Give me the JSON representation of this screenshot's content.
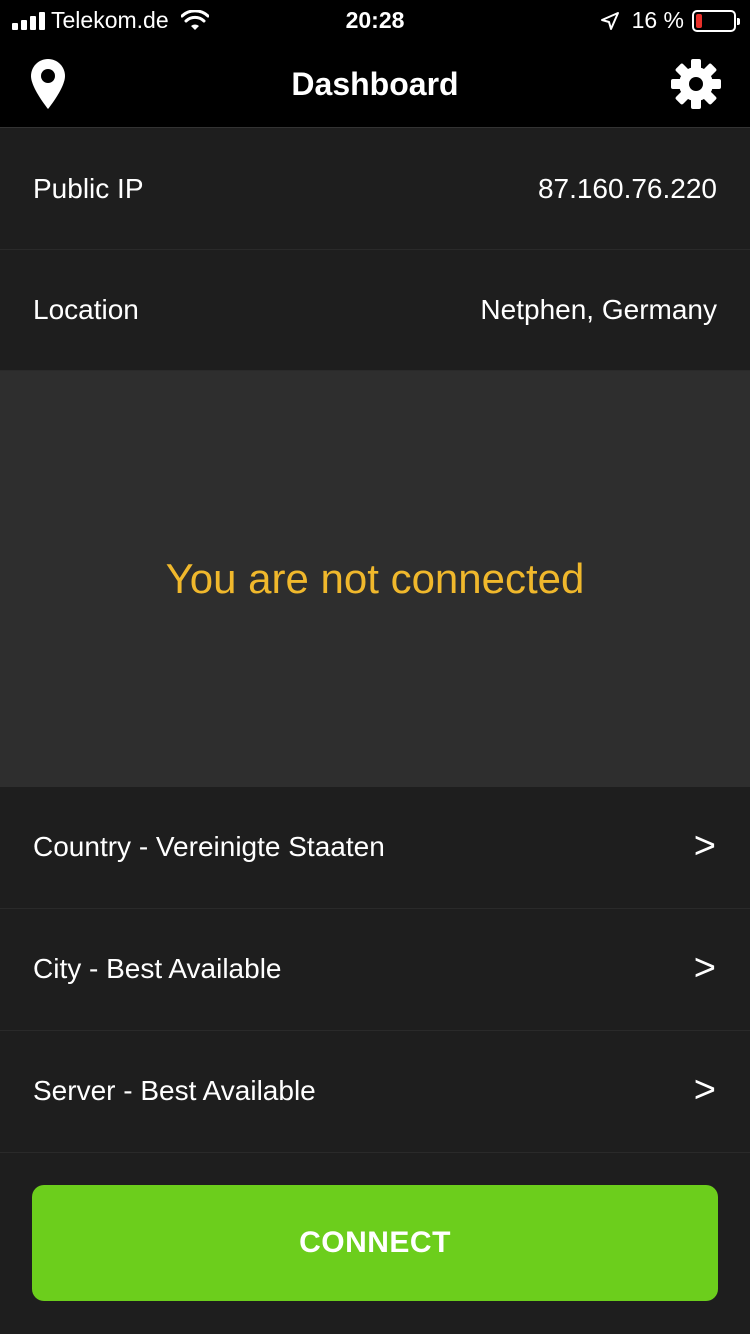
{
  "status_bar": {
    "carrier": "Telekom.de",
    "time": "20:28",
    "battery_percent": "16 %",
    "battery_level": 0.16,
    "battery_color": "#e8302a"
  },
  "nav": {
    "title": "Dashboard",
    "left_icon": "location-pin-icon",
    "right_icon": "gear-icon"
  },
  "info": {
    "public_ip_label": "Public IP",
    "public_ip_value": "87.160.76.220",
    "location_label": "Location",
    "location_value": "Netphen, Germany"
  },
  "connection": {
    "status_text": "You are not connected",
    "status_color": "#f0b82c"
  },
  "selectors": [
    {
      "label": "Country - Vereinigte Staaten",
      "chevron": ">"
    },
    {
      "label": "City - Best Available",
      "chevron": ">"
    },
    {
      "label": "Server - Best Available",
      "chevron": ">"
    }
  ],
  "connect_button": {
    "label": "CONNECT",
    "color": "#6cce1c"
  }
}
